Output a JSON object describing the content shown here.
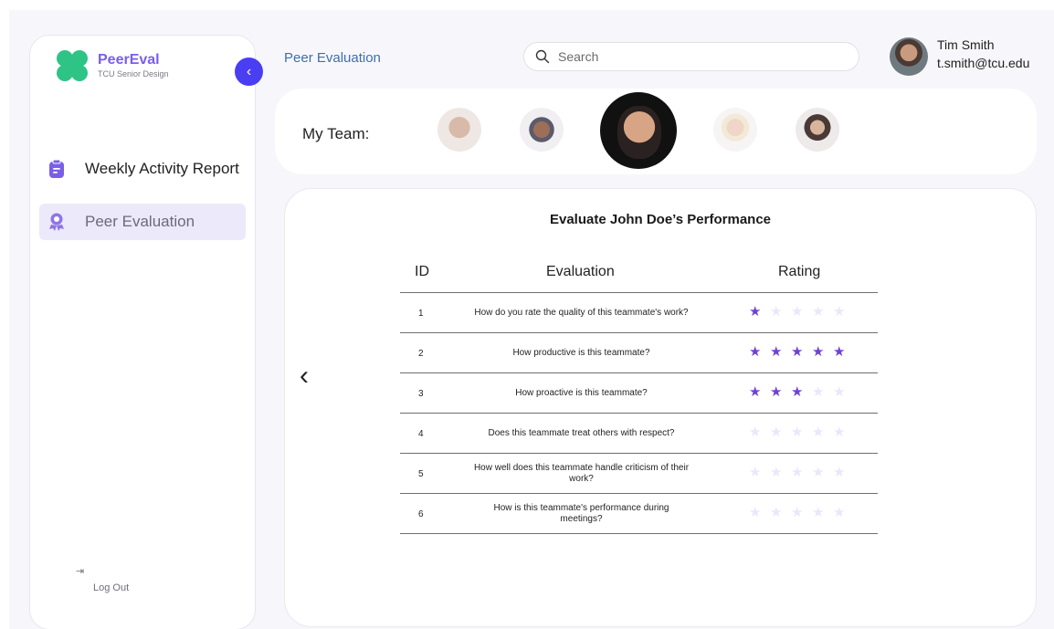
{
  "brand": {
    "name": "PeerEval",
    "subtitle": "TCU Senior Design"
  },
  "sidebar": {
    "items": [
      {
        "label": "Weekly Activity Report",
        "icon": "clipboard-icon",
        "active": false
      },
      {
        "label": "Peer Evaluation",
        "icon": "award-icon",
        "active": true
      }
    ],
    "logout_label": "Log Out"
  },
  "header": {
    "page_title": "Peer Evaluation",
    "search_placeholder": "Search",
    "user": {
      "name": "Tim Smith",
      "email": "t.smith@tcu.edu"
    }
  },
  "team": {
    "label": "My Team:",
    "members": [
      "member-1",
      "member-2",
      "member-3-selected",
      "member-4",
      "member-5"
    ],
    "selected_index": 2
  },
  "evaluation": {
    "title": "Evaluate John Doe’s Performance",
    "columns": {
      "id": "ID",
      "evaluation": "Evaluation",
      "rating": "Rating"
    },
    "max_rating": 5,
    "rows": [
      {
        "id": "1",
        "question": "How do you rate the quality of this teammate's work?",
        "rating": 1
      },
      {
        "id": "2",
        "question": "How productive is this teammate?",
        "rating": 5
      },
      {
        "id": "3",
        "question": "How proactive is this teammate?",
        "rating": 3
      },
      {
        "id": "4",
        "question": "Does this teammate treat others with respect?",
        "rating": 0
      },
      {
        "id": "5",
        "question": "How well does this teammate handle criticism of their work?",
        "rating": 0
      },
      {
        "id": "6",
        "question": "How is this teammate's performance during meetings?",
        "rating": 0
      }
    ]
  },
  "colors": {
    "brand_purple": "#7b5ee8",
    "brand_green": "#2ec486",
    "accent_blue": "#4a3ef2",
    "star_on": "#6f42d1",
    "star_off": "#ece6fb",
    "active_nav_bg": "#ece9fb"
  }
}
